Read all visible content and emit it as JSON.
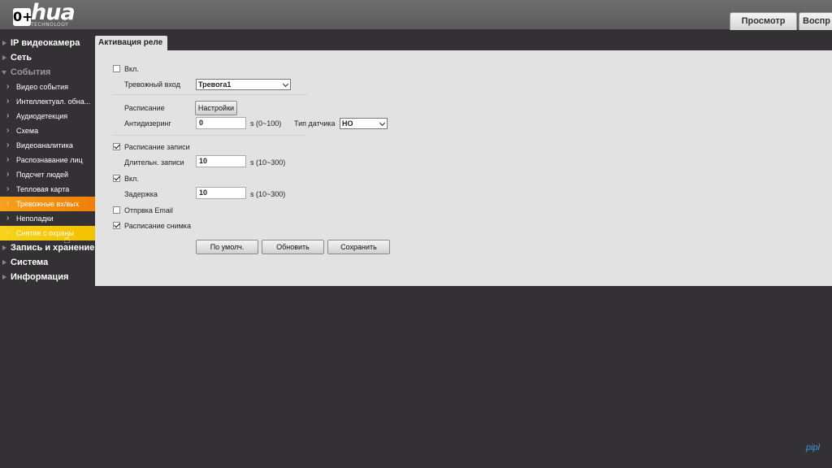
{
  "brand": {
    "logo_text": "hua",
    "logo_sub": "TECHNOLOGY",
    "age_rating": "0+"
  },
  "top_tabs": [
    "Просмотр",
    "Воспр"
  ],
  "sidebar": {
    "groups": [
      {
        "label": "IP видеокамера"
      },
      {
        "label": "Сеть"
      },
      {
        "label": "События"
      },
      {
        "label": "Запись и хранение"
      },
      {
        "label": "Система"
      },
      {
        "label": "Информация"
      }
    ],
    "items": [
      {
        "label": "Видео события"
      },
      {
        "label": "Интеллектуал. обна..."
      },
      {
        "label": "Аудиодетекция"
      },
      {
        "label": "Схема"
      },
      {
        "label": "Видеоаналитика"
      },
      {
        "label": "Распознавание лиц"
      },
      {
        "label": "Подсчет людей"
      },
      {
        "label": "Тепловая карта"
      },
      {
        "label": "Тревожные вх/вых"
      },
      {
        "label": "Неполадки"
      },
      {
        "label": "Снятие с охраны"
      }
    ]
  },
  "panel": {
    "tab_title": "Активация реле",
    "enable_label": "Вкл.",
    "enable_checked": false,
    "alarm_input_label": "Тревожный вход",
    "alarm_input_value": "Тревога1",
    "schedule_label": "Расписание",
    "settings_button": "Настройки",
    "antidither_label": "Антидизеринг",
    "antidither_value": "0",
    "antidither_unit": "s (0~100)",
    "sensor_type_label": "Тип датчика",
    "sensor_type_value": "НО",
    "record_schedule_label": "Расписание записи",
    "record_schedule_checked": true,
    "record_duration_label": "Длительн. записи",
    "record_duration_value": "10",
    "record_duration_unit": "s (10~300)",
    "relay_enable_label": "Вкл.",
    "relay_enable_checked": true,
    "delay_label": "Задержка",
    "delay_value": "10",
    "delay_unit": "s (10~300)",
    "email_label": "Отпрвка Email",
    "email_checked": false,
    "snapshot_label": "Расписание снимка",
    "snapshot_checked": true,
    "default_button": "По умолч.",
    "refresh_button": "Обновить",
    "save_button": "Сохранить"
  },
  "watermark": "pipl"
}
